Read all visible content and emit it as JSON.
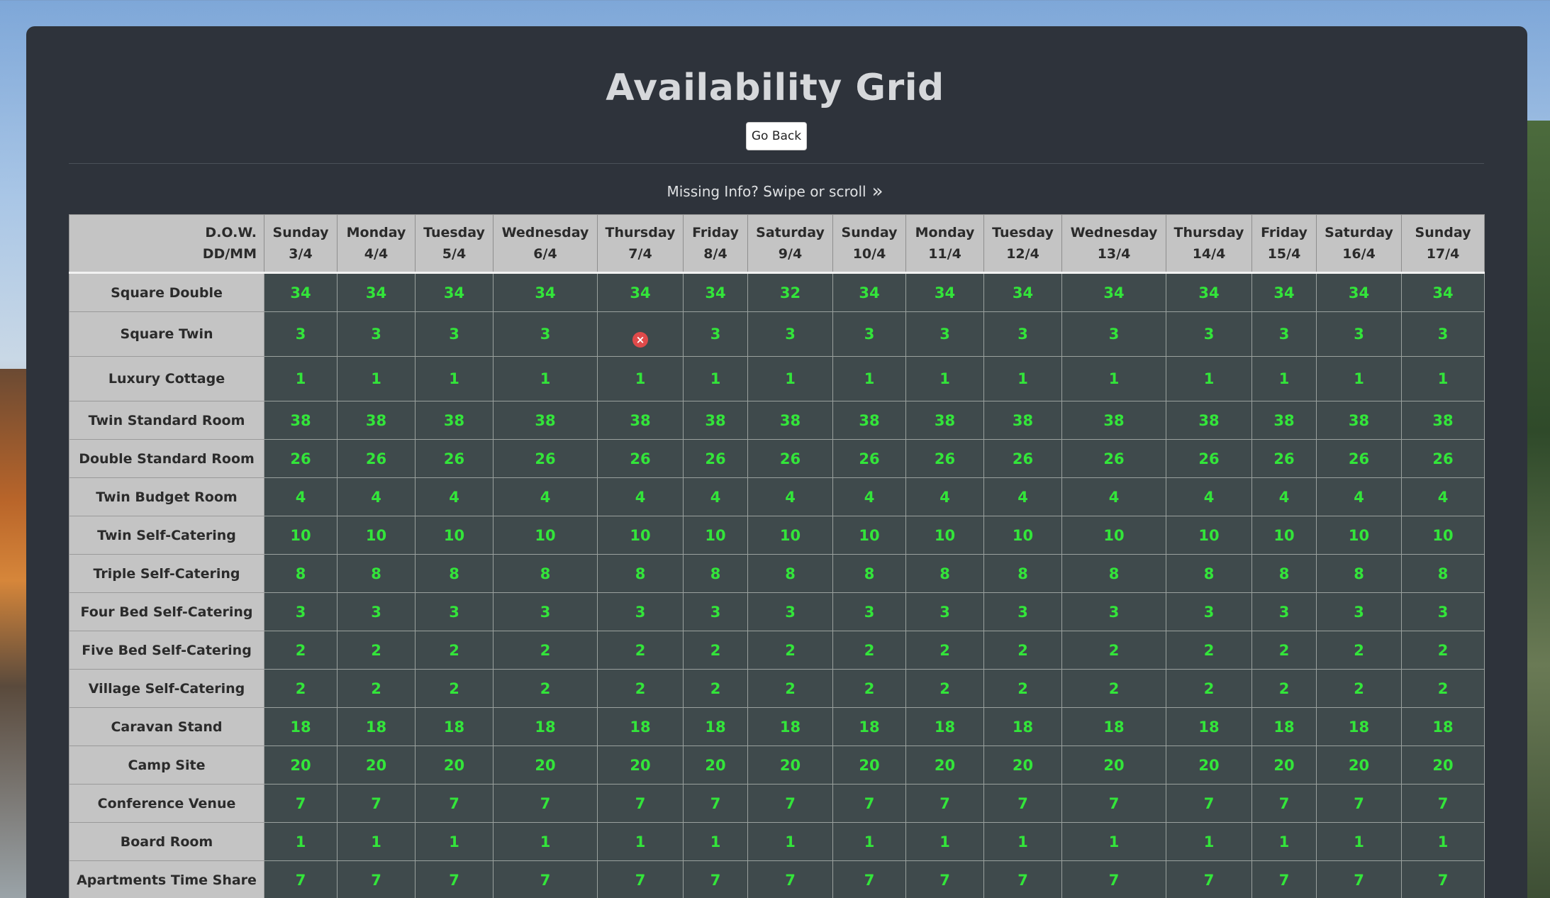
{
  "page": {
    "title": "Availability Grid",
    "go_back_label": "Go Back",
    "hint_text": "Missing Info? Swipe or scroll",
    "hint_icon": "double-chevron-right-icon"
  },
  "grid": {
    "corner_top": "D.O.W.",
    "corner_bottom": "DD/MM",
    "columns": [
      {
        "dow": "Sunday",
        "date": "3/4"
      },
      {
        "dow": "Monday",
        "date": "4/4"
      },
      {
        "dow": "Tuesday",
        "date": "5/4"
      },
      {
        "dow": "Wednesday",
        "date": "6/4"
      },
      {
        "dow": "Thursday",
        "date": "7/4"
      },
      {
        "dow": "Friday",
        "date": "8/4"
      },
      {
        "dow": "Saturday",
        "date": "9/4"
      },
      {
        "dow": "Sunday",
        "date": "10/4"
      },
      {
        "dow": "Monday",
        "date": "11/4"
      },
      {
        "dow": "Tuesday",
        "date": "12/4"
      },
      {
        "dow": "Wednesday",
        "date": "13/4"
      },
      {
        "dow": "Thursday",
        "date": "14/4"
      },
      {
        "dow": "Friday",
        "date": "15/4"
      },
      {
        "dow": "Saturday",
        "date": "16/4"
      },
      {
        "dow": "Sunday",
        "date": "17/4"
      }
    ],
    "rows": [
      {
        "room": "Square Double",
        "values": [
          "34",
          "34",
          "34",
          "34",
          "34",
          "34",
          "32",
          "34",
          "34",
          "34",
          "34",
          "34",
          "34",
          "34",
          "34"
        ]
      },
      {
        "room": "Square Twin",
        "values": [
          "3",
          "3",
          "3",
          "3",
          "unavailable",
          "3",
          "3",
          "3",
          "3",
          "3",
          "3",
          "3",
          "3",
          "3",
          "3"
        ]
      },
      {
        "room": "Luxury Cottage",
        "values": [
          "1",
          "1",
          "1",
          "1",
          "1",
          "1",
          "1",
          "1",
          "1",
          "1",
          "1",
          "1",
          "1",
          "1",
          "1"
        ]
      },
      {
        "room": "Twin Standard Room",
        "values": [
          "38",
          "38",
          "38",
          "38",
          "38",
          "38",
          "38",
          "38",
          "38",
          "38",
          "38",
          "38",
          "38",
          "38",
          "38"
        ]
      },
      {
        "room": "Double Standard Room",
        "values": [
          "26",
          "26",
          "26",
          "26",
          "26",
          "26",
          "26",
          "26",
          "26",
          "26",
          "26",
          "26",
          "26",
          "26",
          "26"
        ]
      },
      {
        "room": "Twin Budget Room",
        "values": [
          "4",
          "4",
          "4",
          "4",
          "4",
          "4",
          "4",
          "4",
          "4",
          "4",
          "4",
          "4",
          "4",
          "4",
          "4"
        ]
      },
      {
        "room": "Twin Self-Catering",
        "values": [
          "10",
          "10",
          "10",
          "10",
          "10",
          "10",
          "10",
          "10",
          "10",
          "10",
          "10",
          "10",
          "10",
          "10",
          "10"
        ]
      },
      {
        "room": "Triple Self-Catering",
        "values": [
          "8",
          "8",
          "8",
          "8",
          "8",
          "8",
          "8",
          "8",
          "8",
          "8",
          "8",
          "8",
          "8",
          "8",
          "8"
        ]
      },
      {
        "room": "Four Bed Self-Catering",
        "values": [
          "3",
          "3",
          "3",
          "3",
          "3",
          "3",
          "3",
          "3",
          "3",
          "3",
          "3",
          "3",
          "3",
          "3",
          "3"
        ]
      },
      {
        "room": "Five Bed Self-Catering",
        "values": [
          "2",
          "2",
          "2",
          "2",
          "2",
          "2",
          "2",
          "2",
          "2",
          "2",
          "2",
          "2",
          "2",
          "2",
          "2"
        ]
      },
      {
        "room": "Village Self-Catering",
        "values": [
          "2",
          "2",
          "2",
          "2",
          "2",
          "2",
          "2",
          "2",
          "2",
          "2",
          "2",
          "2",
          "2",
          "2",
          "2"
        ]
      },
      {
        "room": "Caravan Stand",
        "values": [
          "18",
          "18",
          "18",
          "18",
          "18",
          "18",
          "18",
          "18",
          "18",
          "18",
          "18",
          "18",
          "18",
          "18",
          "18"
        ]
      },
      {
        "room": "Camp Site",
        "values": [
          "20",
          "20",
          "20",
          "20",
          "20",
          "20",
          "20",
          "20",
          "20",
          "20",
          "20",
          "20",
          "20",
          "20",
          "20"
        ]
      },
      {
        "room": "Conference Venue",
        "values": [
          "7",
          "7",
          "7",
          "7",
          "7",
          "7",
          "7",
          "7",
          "7",
          "7",
          "7",
          "7",
          "7",
          "7",
          "7"
        ]
      },
      {
        "room": "Board Room",
        "values": [
          "1",
          "1",
          "1",
          "1",
          "1",
          "1",
          "1",
          "1",
          "1",
          "1",
          "1",
          "1",
          "1",
          "1",
          "1"
        ]
      },
      {
        "room": "Apartments Time Share",
        "values": [
          "7",
          "7",
          "7",
          "7",
          "7",
          "7",
          "7",
          "7",
          "7",
          "7",
          "7",
          "7",
          "7",
          "7",
          "7"
        ]
      }
    ]
  },
  "colors": {
    "panel_bg": "#2e333b",
    "available_text": "#33e53a",
    "cell_bg": "#3f4a4c",
    "header_bg": "#c4c4c4",
    "unavailable_icon": "#e04a4a"
  }
}
